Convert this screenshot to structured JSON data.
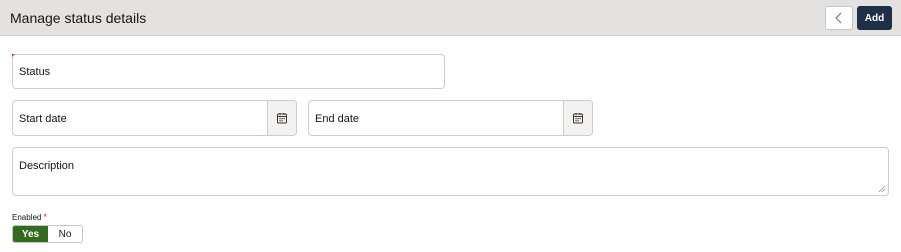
{
  "header": {
    "title": "Manage status details",
    "back_icon": "chevron-left-icon",
    "add_label": "Add"
  },
  "form": {
    "status_label": "Status",
    "start_date_label": "Start date",
    "end_date_label": "End date",
    "description_label": "Description",
    "calendar_icon": "calendar-icon",
    "enabled_label": "Enabled",
    "required_marker": "*",
    "toggle": {
      "yes_label": "Yes",
      "no_label": "No",
      "selected": "Yes"
    }
  },
  "colors": {
    "header_bg": "#e4e2e0",
    "primary_button": "#1f2f47",
    "toggle_selected": "#356b1e",
    "required": "#c7312b"
  }
}
